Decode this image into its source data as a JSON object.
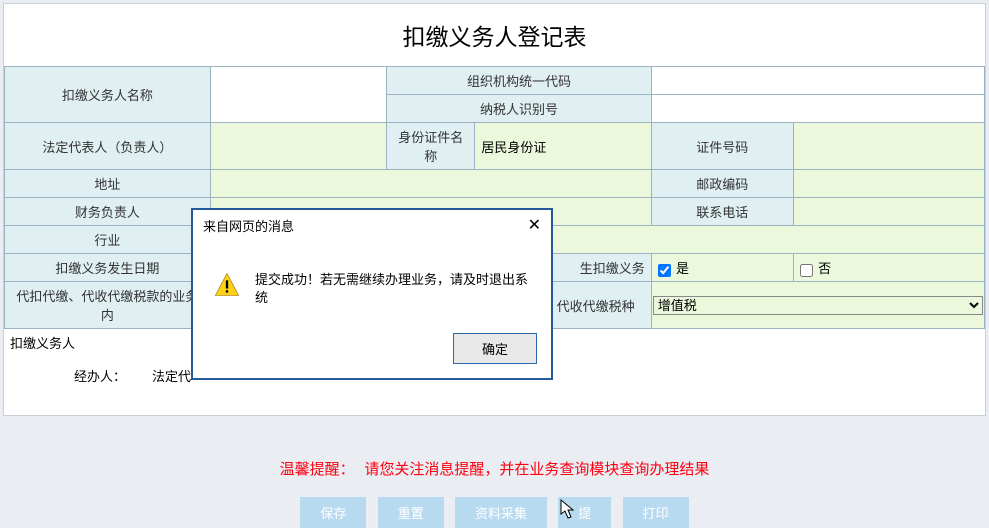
{
  "title": "扣缴义务人登记表",
  "fields": {
    "agent_name_label": "扣缴义务人名称",
    "agent_name_value": "",
    "org_code_label": "组织机构统一代码",
    "org_code_value": "",
    "tax_id_label": "纳税人识别号",
    "tax_id_value": "",
    "legal_rep_label": "法定代表人（负责人）",
    "legal_rep_value": "",
    "id_type_label": "身份证件名称",
    "id_type_value": "居民身份证",
    "id_number_label": "证件号码",
    "id_number_value": "",
    "address_label": "地址",
    "address_value": "",
    "postcode_label": "邮政编码",
    "postcode_value": "",
    "fin_director_label": "财务负责人",
    "fin_director_value": "",
    "contact_phone_label": "联系电话",
    "contact_phone_value": "",
    "industry_label": "行业",
    "industry_value": "",
    "occur_date_label": "扣缴义务发生日期",
    "occur_date_value": "",
    "generated_label": "生扣缴义务",
    "yes_label": "是",
    "no_label": "否",
    "tax_biz_label": "代扣代缴、代收代缴税款的业务内",
    "tax_biz_value": "",
    "tax_type_label": "代扣代缴、代收代缴税种",
    "tax_type_value": "增值税",
    "agent_section": "扣缴义务人",
    "handler_label": "经办人：",
    "legal_rep2_label": "法定代"
  },
  "footer": {
    "prefix": "温馨提醒：",
    "text": "请您关注消息提醒，并在业务查询模块查询办理结果"
  },
  "buttons": {
    "save": "保存",
    "reset": "重置",
    "collect": "资料采集",
    "submit": "提",
    "print": "打印"
  },
  "dialog": {
    "title": "来自网页的消息",
    "message": "提交成功！若无需继续办理业务，请及时退出系统",
    "ok": "确定"
  }
}
